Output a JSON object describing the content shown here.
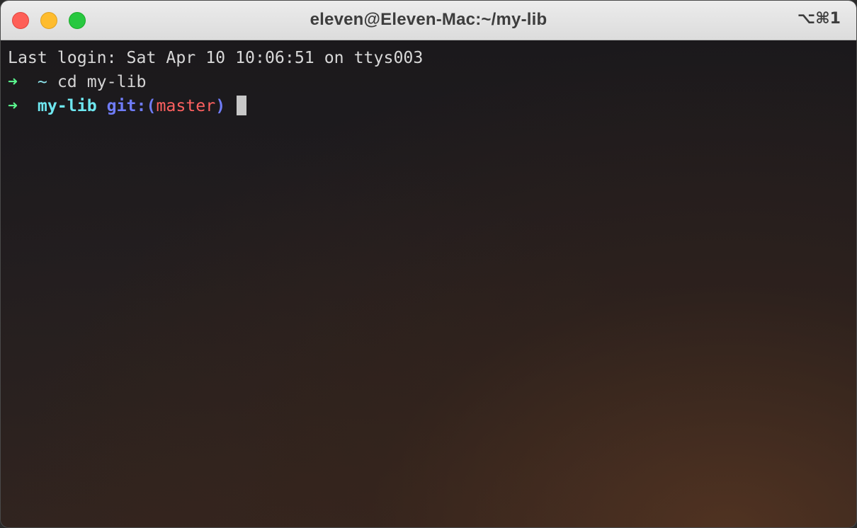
{
  "window": {
    "title": "eleven@Eleven-Mac:~/my-lib",
    "shortcut": "⌥⌘1",
    "traffic_lights": {
      "close": "#fe5f57",
      "minimize": "#febc2e",
      "zoom": "#28c840"
    }
  },
  "terminal": {
    "lines": [
      {
        "text": "Last login: Sat Apr 10 10:06:51 on ttys003"
      },
      {
        "arrow": "➜",
        "cwd": "~",
        "command": "cd my-lib"
      },
      {
        "arrow": "➜",
        "dir": "my-lib",
        "git_label": "git:(",
        "branch": "master",
        "git_close": ")"
      }
    ],
    "colors": {
      "arrow": "#5af78e",
      "dir": "#6ee7f0",
      "git_label": "#6f7cf7",
      "branch": "#ff6160",
      "text": "#d8d8d8"
    }
  }
}
